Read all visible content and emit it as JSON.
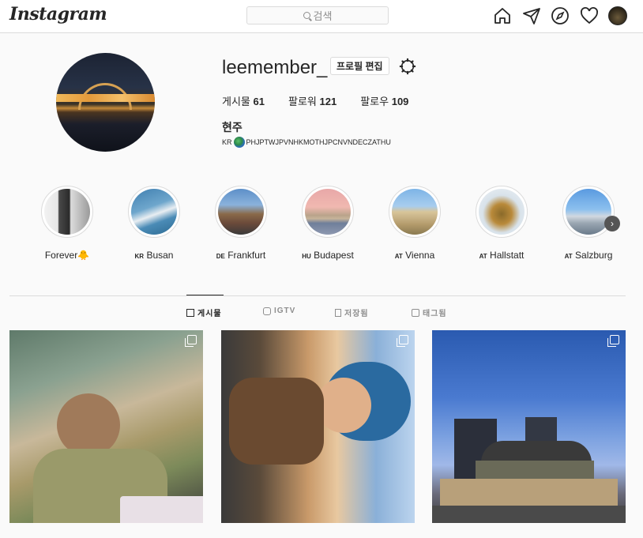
{
  "nav": {
    "logo": "Instagram",
    "search_placeholder": "검색",
    "icons": [
      "home-icon",
      "direct-icon",
      "explore-icon",
      "activity-icon",
      "profile-avatar"
    ]
  },
  "profile": {
    "username": "leemember_",
    "edit_button": "프로필 편집",
    "stats": {
      "posts_label": "게시물",
      "posts": "61",
      "followers_label": "팔로워",
      "followers": "121",
      "following_label": "팔로우",
      "following": "109"
    },
    "full_name": "현주",
    "bio_prefix": "KR",
    "bio_suffix": "PHJPTWJPVNHKMOTHJPCNVNDECZATHU"
  },
  "highlights": [
    {
      "code": "",
      "label": "Forever",
      "emoji": "🐥"
    },
    {
      "code": "KR",
      "label": "Busan"
    },
    {
      "code": "DE",
      "label": "Frankfurt"
    },
    {
      "code": "HU",
      "label": "Budapest"
    },
    {
      "code": "AT",
      "label": "Vienna"
    },
    {
      "code": "AT",
      "label": "Hallstatt"
    },
    {
      "code": "AT",
      "label": "Salzburg"
    }
  ],
  "tabs": [
    {
      "label": "게시물",
      "active": true
    },
    {
      "label": "IGTV",
      "active": false
    },
    {
      "label": "저장됨",
      "active": false
    },
    {
      "label": "태그됨",
      "active": false
    }
  ],
  "colors": {
    "border": "#dbdbdb",
    "text": "#262626",
    "muted": "#8e8e8e",
    "background": "#fafafa"
  }
}
